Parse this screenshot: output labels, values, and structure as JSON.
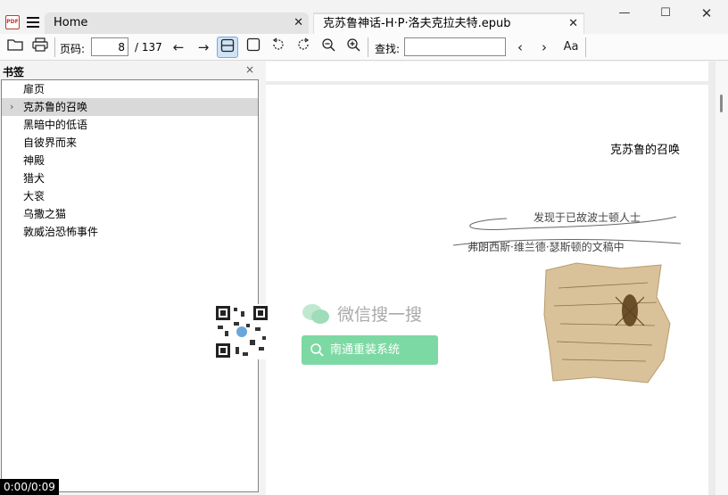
{
  "app": {
    "icon_text": "PDF",
    "tabs": [
      {
        "label": "Home"
      },
      {
        "label": "克苏鲁神话-H·P·洛夫克拉夫特.epub"
      }
    ]
  },
  "toolbar": {
    "page_label": "页码:",
    "current_page": "8",
    "total_pages": "/ 137",
    "find_label": "查找:",
    "find_value": "",
    "font_button": "Aa"
  },
  "sidebar": {
    "title": "书签",
    "close": "×",
    "items": [
      {
        "label": "扉页"
      },
      {
        "label": "克苏鲁的召唤"
      },
      {
        "label": "黑暗中的低语"
      },
      {
        "label": "自彼界而来"
      },
      {
        "label": "神殿"
      },
      {
        "label": "猎犬"
      },
      {
        "label": "大衮"
      },
      {
        "label": "乌撒之猫"
      },
      {
        "label": "敦威治恐怖事件"
      }
    ]
  },
  "document": {
    "chapter_title": "克苏鲁的召唤",
    "handwritten_line1": "发现于已故波士顿人士",
    "handwritten_line2": "弗朗西斯·维兰德·瑟斯顿的文稿中"
  },
  "watermark": {
    "title": "微信搜一搜",
    "button": "南通重装系统"
  },
  "video_time": "0:00/0:09"
}
